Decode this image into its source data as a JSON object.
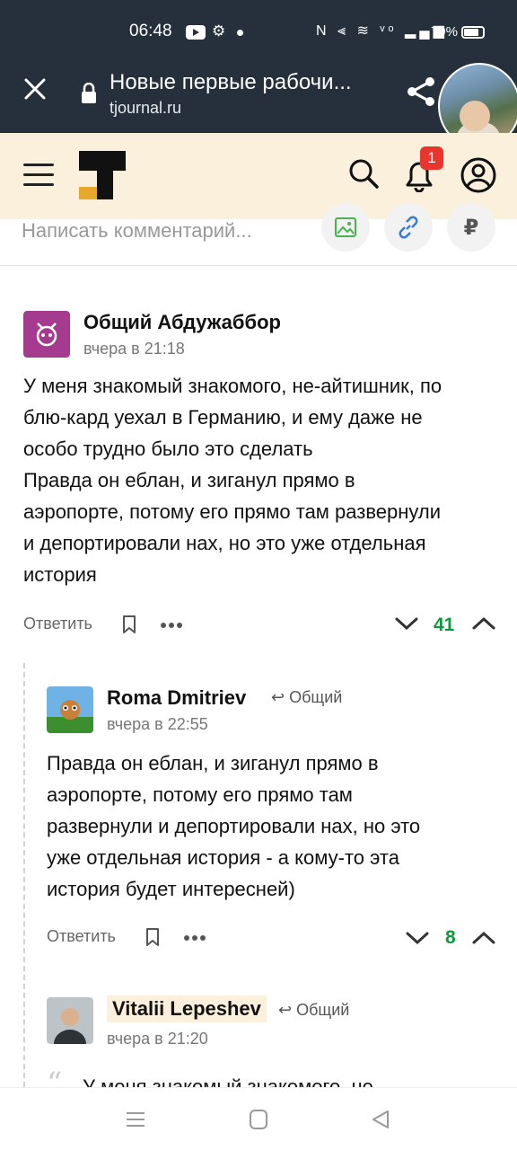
{
  "status_bar": {
    "time": "06:48",
    "battery_text": "79%",
    "battery_level": 0.79,
    "misc_icon": "⚙",
    "right_icons": "N ⫷ ≋ ᵛᵒ ▂▄▆"
  },
  "browser": {
    "title": "Новые первые рабочи...",
    "url": "tjournal.ru"
  },
  "header": {
    "notification_count": "1",
    "accent_color": "#fbf0dc"
  },
  "comment_input": {
    "placeholder": "Написать комментарий..."
  },
  "comments": [
    {
      "author": "Общий Абдужаббор",
      "time": "вчера в 21:18",
      "lines": [
        "У меня знакомый знакомого, не-айтишник, по",
        "блю-кард уехал в Германию, и ему даже не",
        "особо трудно было это сделать",
        "Правда он еблан, и зиганул прямо в",
        "аэропорте, потому его прямо там развернули",
        "и депортировали нах, но это уже отдельная",
        "история"
      ],
      "reply_label": "Ответить",
      "votes": "41"
    },
    {
      "author": "Roma Dmitriev",
      "reply_to": "Общий",
      "time": "вчера в 22:55",
      "lines": [
        "Правда он еблан, и зиганул прямо в",
        "аэропорте, потому его прямо там",
        "развернули и депортировали нах, но это",
        "уже отдельная история - а кому-то эта",
        "история будет интересней)"
      ],
      "reply_label": "Ответить",
      "votes": "8"
    },
    {
      "author": "Vitalii Lepeshev",
      "reply_to": "Общий",
      "time": "вчера в 21:20",
      "quote_preview": "У меня знакомый знакомого, не-"
    }
  ]
}
